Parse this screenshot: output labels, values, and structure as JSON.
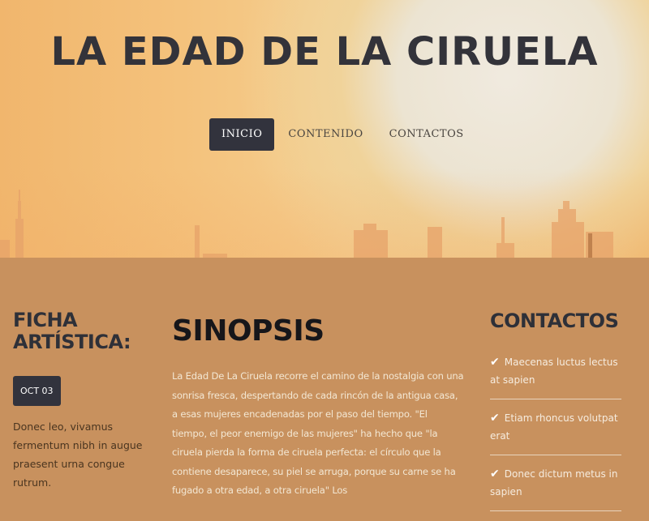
{
  "header": {
    "site_title": "LA EDAD DE LA CIRUELA"
  },
  "nav": {
    "items": [
      {
        "label": "INICIO",
        "active": true
      },
      {
        "label": "CONTENIDO",
        "active": false
      },
      {
        "label": "CONTACTOS",
        "active": false
      }
    ]
  },
  "ficha": {
    "title": "FICHA ARTÍSTICA:",
    "date": "OCT 03",
    "text": "Donec leo, vivamus fermentum nibh in augue praesent urna congue rutrum."
  },
  "sinopsis": {
    "title": "SINOPSIS",
    "text": "La Edad De La Ciruela recorre el camino de la nostalgia con una sonrisa fresca, despertando de cada rincón de la antigua casa, a esas mujeres encadenadas por el paso del tiempo. \"El tiempo, el peor enemigo de las mujeres\" ha hecho que \"la ciruela pierda la forma de ciruela perfecta: el círculo que la contiene desaparece, su piel se arruga, porque su carne se ha fugado a otra edad, a otra ciruela\" Los"
  },
  "contactos": {
    "title": "CONTACTOS",
    "items": [
      {
        "text": "Maecenas luctus lectus at sapien",
        "icon": "check-icon"
      },
      {
        "text": "Etiam rhoncus volutpat erat",
        "icon": "check-icon"
      },
      {
        "text": "Donec dictum metus in sapien",
        "icon": "check-icon"
      }
    ]
  },
  "colors": {
    "accent_dark": "#32333d",
    "content_bg": "#c8915e"
  }
}
